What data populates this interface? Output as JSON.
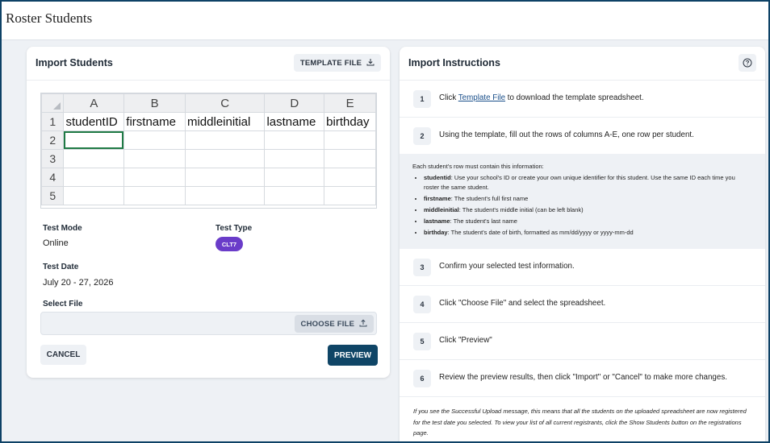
{
  "page": {
    "title": "Roster Students"
  },
  "left": {
    "title": "Import Students",
    "template_button": "TEMPLATE FILE",
    "sheet": {
      "columns": [
        "A",
        "B",
        "C",
        "D",
        "E"
      ],
      "rows": [
        "1",
        "2",
        "3",
        "4",
        "5"
      ],
      "header_values": [
        "studentID",
        "firstname",
        "middleinitial",
        "lastname",
        "birthday"
      ]
    },
    "test_mode_label": "Test Mode",
    "test_mode_value": "Online",
    "test_type_label": "Test Type",
    "test_type_value": "CLT7",
    "test_date_label": "Test Date",
    "test_date_value": "July 20 - 27, 2026",
    "select_file_label": "Select File",
    "choose_file_button": "CHOOSE FILE",
    "cancel_button": "CANCEL",
    "preview_button": "PREVIEW"
  },
  "right": {
    "title": "Import Instructions",
    "steps": [
      {
        "num": "1",
        "pre": "Click ",
        "link": "Template File",
        "post": " to download the template spreadsheet."
      },
      {
        "num": "2",
        "text": "Using the template, fill out the rows of columns A-E, one row per student."
      },
      {
        "num": "3",
        "text": "Confirm your selected test information."
      },
      {
        "num": "4",
        "text": "Click \"Choose File\" and select the spreadsheet."
      },
      {
        "num": "5",
        "text": "Click \"Preview\""
      },
      {
        "num": "6",
        "text": "Review the preview results, then click \"Import\" or \"Cancel\" to make more changes."
      }
    ],
    "info_intro": "Each student's row must contain this information:",
    "info_items": [
      {
        "key": "studentid",
        "desc": ": Use your school's ID or create your own unique identifier for this student. Use the same ID each time you roster the same student."
      },
      {
        "key": "firstname",
        "desc": ": The student's full first name"
      },
      {
        "key": "middleinitial",
        "desc": ": The student's middle initial (can be left blank)"
      },
      {
        "key": "lastname",
        "desc": ": The student's last name"
      },
      {
        "key": "birthday",
        "desc": ": The student's date of birth, formatted as mm/dd/yyyy or yyyy-mm-dd"
      }
    ],
    "footnote": "If you see the Successful Upload message, this means that all the students on the uploaded spreadsheet are now registered for the test date you selected. To view your list of all current registrants, click the Show Students button on the registrations page."
  },
  "colors": {
    "primary": "#0f4566",
    "pill": "#6a3cc9",
    "background": "#eef1f5"
  }
}
